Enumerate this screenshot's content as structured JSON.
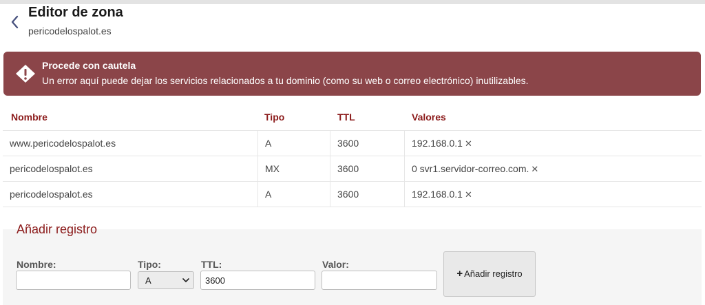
{
  "header": {
    "title": "Editor de zona",
    "subtitle": "pericodelospalot.es"
  },
  "icons": {
    "back": "chevron-left-icon",
    "warning": "warning-diamond-icon",
    "delete": "close-icon",
    "add": "plus-icon",
    "select": "chevron-down-icon"
  },
  "colors": {
    "alert_bg": "#8b4549",
    "accent": "#8b1a1a",
    "back_icon": "#4a5480"
  },
  "alert": {
    "title": "Procede con cautela",
    "message": "Un error aquí puede dejar los servicios relacionados a tu dominio (como su web o correo electrónico) inutilizables."
  },
  "table": {
    "headers": {
      "name": "Nombre",
      "type": "Tipo",
      "ttl": "TTL",
      "values": "Valores"
    },
    "rows": [
      {
        "name": "www.pericodelospalot.es",
        "type": "A",
        "ttl": "3600",
        "value": "192.168.0.1"
      },
      {
        "name": "pericodelospalot.es",
        "type": "MX",
        "ttl": "3600",
        "value": "0 svr1.servidor-correo.com."
      },
      {
        "name": "pericodelospalot.es",
        "type": "A",
        "ttl": "3600",
        "value": "192.168.0.1"
      }
    ],
    "delete_glyph": "✕"
  },
  "add_form": {
    "title": "Añadir registro",
    "name_label": "Nombre:",
    "name_value": "",
    "type_label": "Tipo:",
    "type_selected": "A",
    "ttl_label": "TTL:",
    "ttl_value": "3600",
    "value_label": "Valor:",
    "value_value": "",
    "submit_plus": "+",
    "submit_label": "Añadir registro"
  }
}
